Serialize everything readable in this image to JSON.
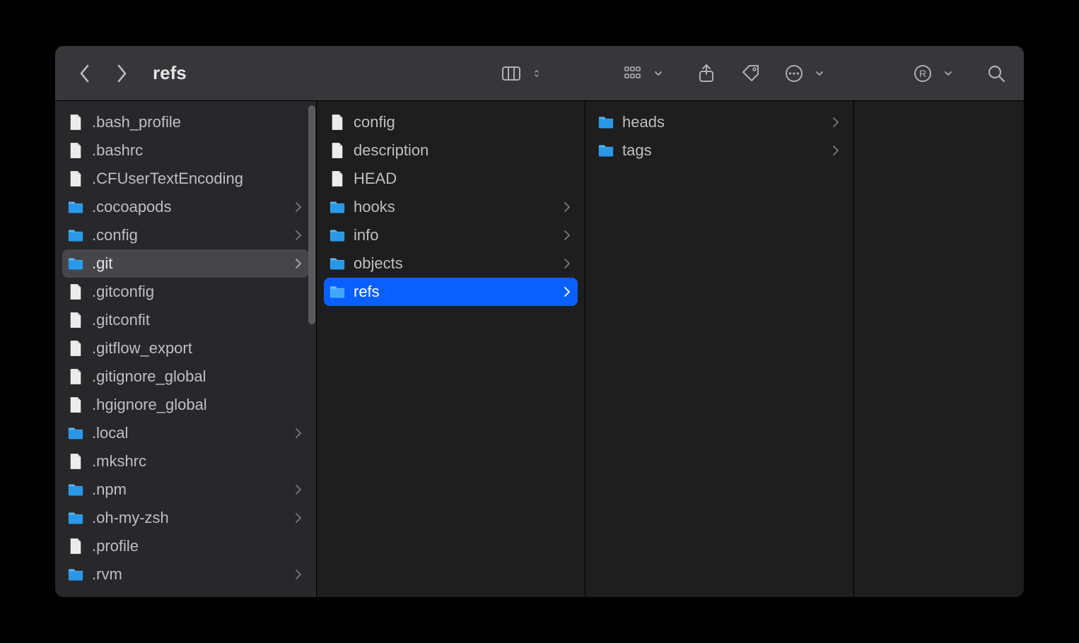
{
  "window": {
    "title": "refs"
  },
  "columns": [
    {
      "items": [
        {
          "name": ".bash_profile",
          "type": "file"
        },
        {
          "name": ".bashrc",
          "type": "file"
        },
        {
          "name": ".CFUserTextEncoding",
          "type": "file"
        },
        {
          "name": ".cocoapods",
          "type": "folder"
        },
        {
          "name": ".config",
          "type": "folder"
        },
        {
          "name": ".git",
          "type": "folder",
          "state": "parent-selected"
        },
        {
          "name": ".gitconfig",
          "type": "file"
        },
        {
          "name": ".gitconfit",
          "type": "file"
        },
        {
          "name": ".gitflow_export",
          "type": "file"
        },
        {
          "name": ".gitignore_global",
          "type": "file"
        },
        {
          "name": ".hgignore_global",
          "type": "file"
        },
        {
          "name": ".local",
          "type": "folder"
        },
        {
          "name": ".mkshrc",
          "type": "file"
        },
        {
          "name": ".npm",
          "type": "folder"
        },
        {
          "name": ".oh-my-zsh",
          "type": "folder"
        },
        {
          "name": ".profile",
          "type": "file"
        },
        {
          "name": ".rvm",
          "type": "folder"
        }
      ]
    },
    {
      "items": [
        {
          "name": "config",
          "type": "file"
        },
        {
          "name": "description",
          "type": "file"
        },
        {
          "name": "HEAD",
          "type": "file"
        },
        {
          "name": "hooks",
          "type": "folder"
        },
        {
          "name": "info",
          "type": "folder"
        },
        {
          "name": "objects",
          "type": "folder"
        },
        {
          "name": "refs",
          "type": "folder",
          "state": "selected"
        }
      ]
    },
    {
      "items": [
        {
          "name": "heads",
          "type": "folder"
        },
        {
          "name": "tags",
          "type": "folder"
        }
      ]
    },
    {
      "items": []
    }
  ]
}
